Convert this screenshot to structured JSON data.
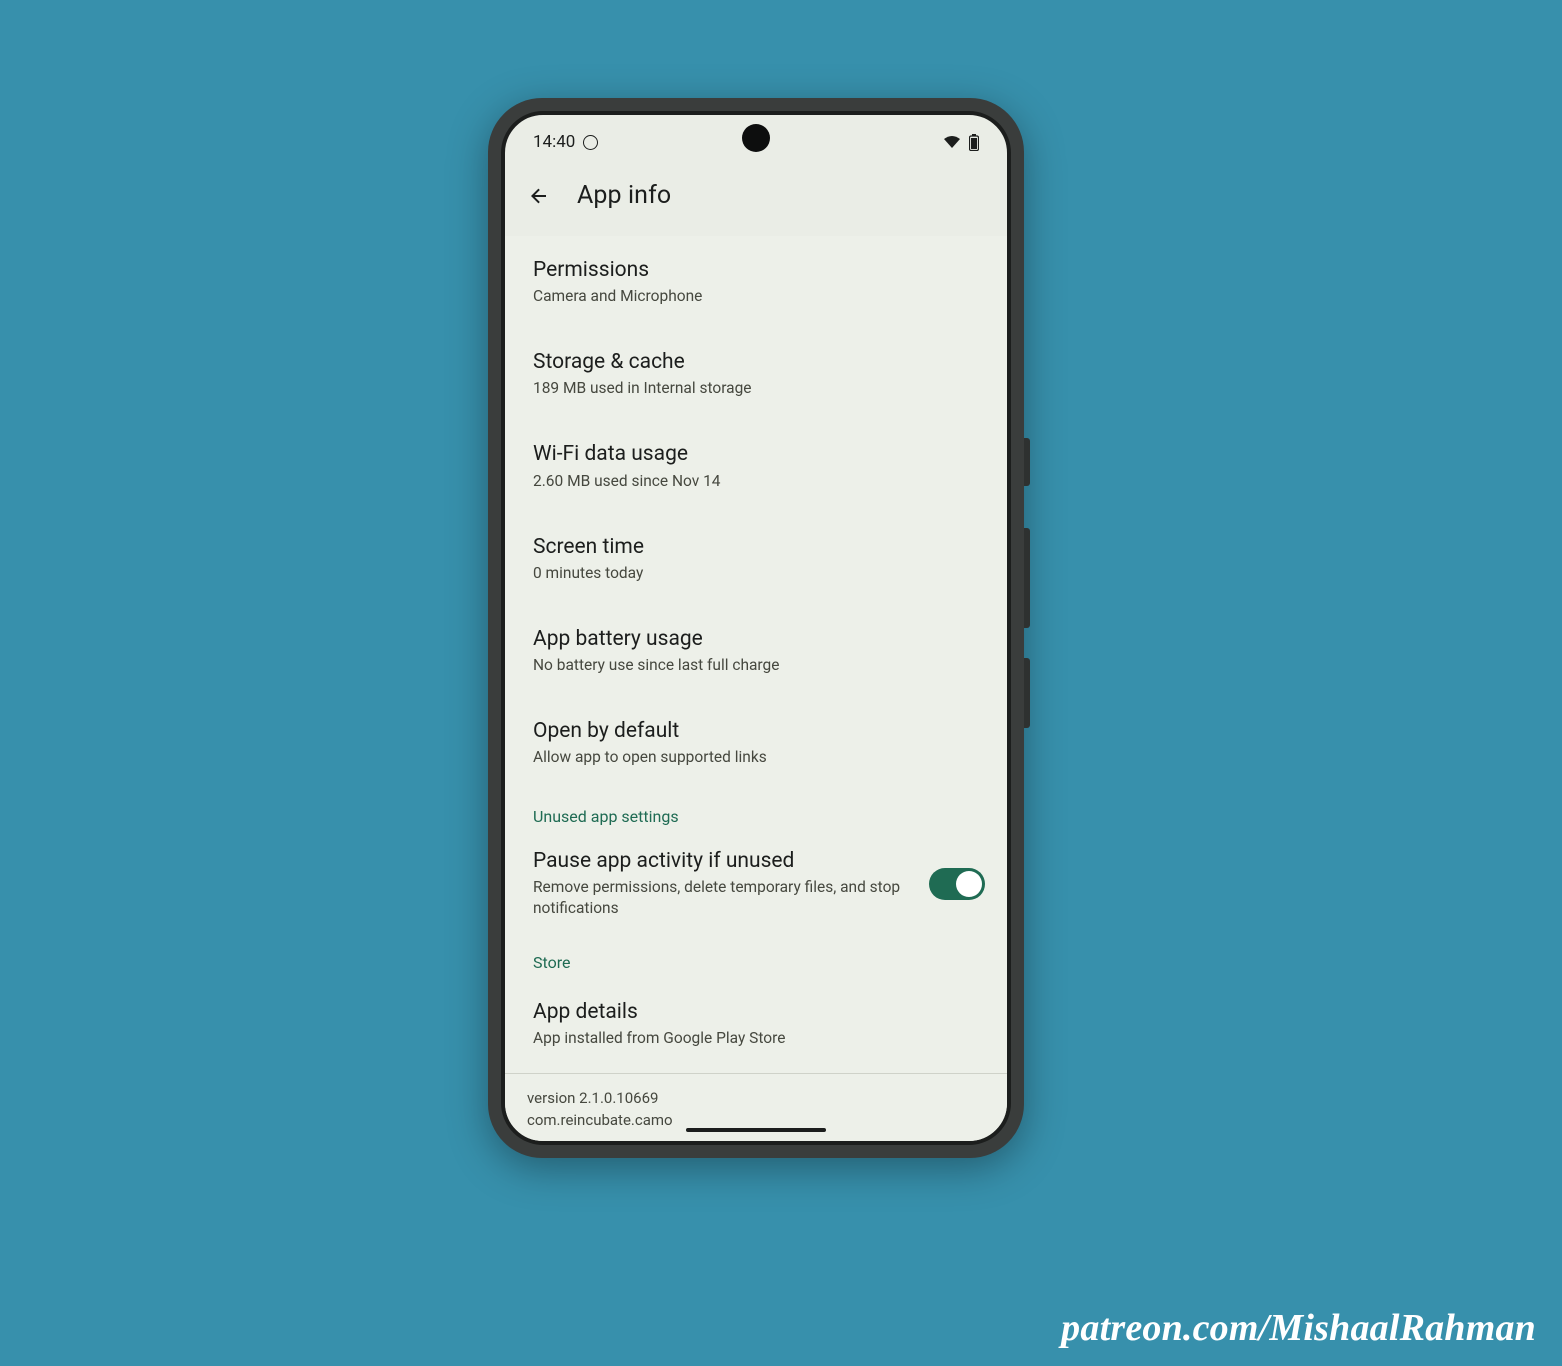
{
  "status_bar": {
    "time": "14:40"
  },
  "header": {
    "title": "App info"
  },
  "settings": [
    {
      "title": "Permissions",
      "sub": "Camera and Microphone"
    },
    {
      "title": "Storage & cache",
      "sub": "189 MB used in Internal storage"
    },
    {
      "title": "Wi-Fi data usage",
      "sub": "2.60 MB used since Nov 14"
    },
    {
      "title": "Screen time",
      "sub": "0 minutes today"
    },
    {
      "title": "App battery usage",
      "sub": "No battery use since last full charge"
    },
    {
      "title": "Open by default",
      "sub": "Allow app to open supported links"
    }
  ],
  "unused_section": {
    "header": "Unused app settings",
    "title": "Pause app activity if unused",
    "sub": "Remove permissions, delete temporary files, and stop notifications",
    "toggle_on": true
  },
  "store_section": {
    "header": "Store",
    "title": "App details",
    "sub": "App installed from Google Play Store"
  },
  "footer": {
    "version": "version 2.1.0.10669",
    "package": "com.reincubate.camo"
  },
  "watermark": "patreon.com/MishaalRahman"
}
